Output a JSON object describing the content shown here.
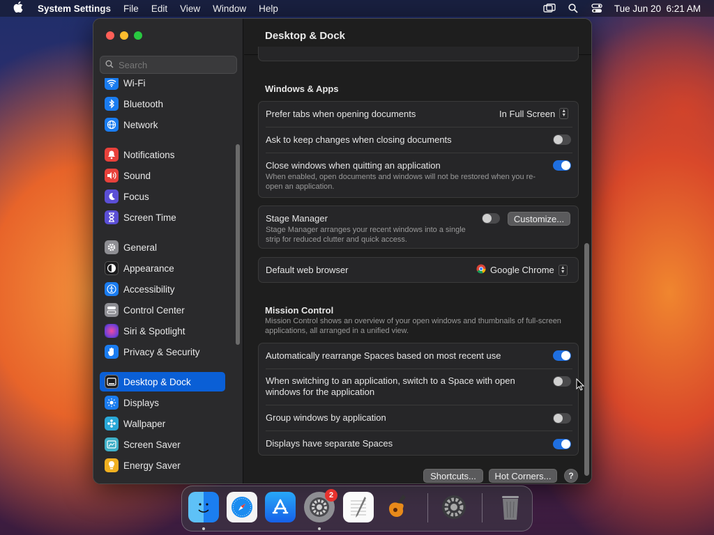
{
  "menubar": {
    "app_name": "System Settings",
    "items": [
      "File",
      "Edit",
      "View",
      "Window",
      "Help"
    ],
    "datetime": "Tue Jun 20  6:21 AM"
  },
  "sidebar": {
    "search_placeholder": "Search",
    "items": [
      {
        "label": "Wi-Fi",
        "icon": "wifi-icon",
        "color": "#1a7cf0"
      },
      {
        "label": "Bluetooth",
        "icon": "bluetooth-icon",
        "color": "#1a7cf0"
      },
      {
        "label": "Network",
        "icon": "globe-icon",
        "color": "#1a7cf0"
      },
      {
        "label": "Notifications",
        "icon": "bell-icon",
        "color": "#e8413b"
      },
      {
        "label": "Sound",
        "icon": "speaker-icon",
        "color": "#e8413b"
      },
      {
        "label": "Focus",
        "icon": "moon-icon",
        "color": "#5b4fd6"
      },
      {
        "label": "Screen Time",
        "icon": "hourglass-icon",
        "color": "#5b4fd6"
      },
      {
        "label": "General",
        "icon": "gear-icon",
        "color": "#8e8e93"
      },
      {
        "label": "Appearance",
        "icon": "appearance-icon",
        "color": "#1c1c1e"
      },
      {
        "label": "Accessibility",
        "icon": "accessibility-icon",
        "color": "#1a7cf0"
      },
      {
        "label": "Control Center",
        "icon": "control-center-icon",
        "color": "#8e8e93"
      },
      {
        "label": "Siri & Spotlight",
        "icon": "siri-icon",
        "color": "#b43fd0"
      },
      {
        "label": "Privacy & Security",
        "icon": "hand-icon",
        "color": "#1a7cf0"
      },
      {
        "label": "Desktop & Dock",
        "icon": "desktop-icon",
        "color": "#1c1c1e"
      },
      {
        "label": "Displays",
        "icon": "sun-icon",
        "color": "#1a7cf0"
      },
      {
        "label": "Wallpaper",
        "icon": "wallpaper-icon",
        "color": "#29a8d8"
      },
      {
        "label": "Screen Saver",
        "icon": "screensaver-icon",
        "color": "#3fb0c8"
      },
      {
        "label": "Energy Saver",
        "icon": "battery-icon",
        "color": "#f0b020"
      }
    ]
  },
  "content": {
    "title": "Desktop & Dock",
    "windows_apps": {
      "title": "Windows & Apps",
      "prefer_tabs_label": "Prefer tabs when opening documents",
      "prefer_tabs_value": "In Full Screen",
      "ask_keep_label": "Ask to keep changes when closing documents",
      "close_windows_label": "Close windows when quitting an application",
      "close_windows_sub": "When enabled, open documents and windows will not be restored when you re-open an application."
    },
    "stage_manager": {
      "label": "Stage Manager",
      "sub": "Stage Manager arranges your recent windows into a single strip for reduced clutter and quick access.",
      "customize": "Customize..."
    },
    "browser": {
      "label": "Default web browser",
      "value": "Google Chrome"
    },
    "mission_control": {
      "title": "Mission Control",
      "desc": "Mission Control shows an overview of your open windows and thumbnails of full-screen applications, all arranged in a unified view.",
      "auto_rearrange": "Automatically rearrange Spaces based on most recent use",
      "switch_space": "When switching to an application, switch to a Space with open windows for the application",
      "group_windows": "Group windows by application",
      "separate_spaces": "Displays have separate Spaces"
    },
    "footer": {
      "shortcuts": "Shortcuts...",
      "hot_corners": "Hot Corners...",
      "help": "?"
    }
  },
  "dock": {
    "settings_badge": "2"
  },
  "colors": {
    "accent": "#1f6fe0",
    "selected": "#0a5fd6"
  }
}
